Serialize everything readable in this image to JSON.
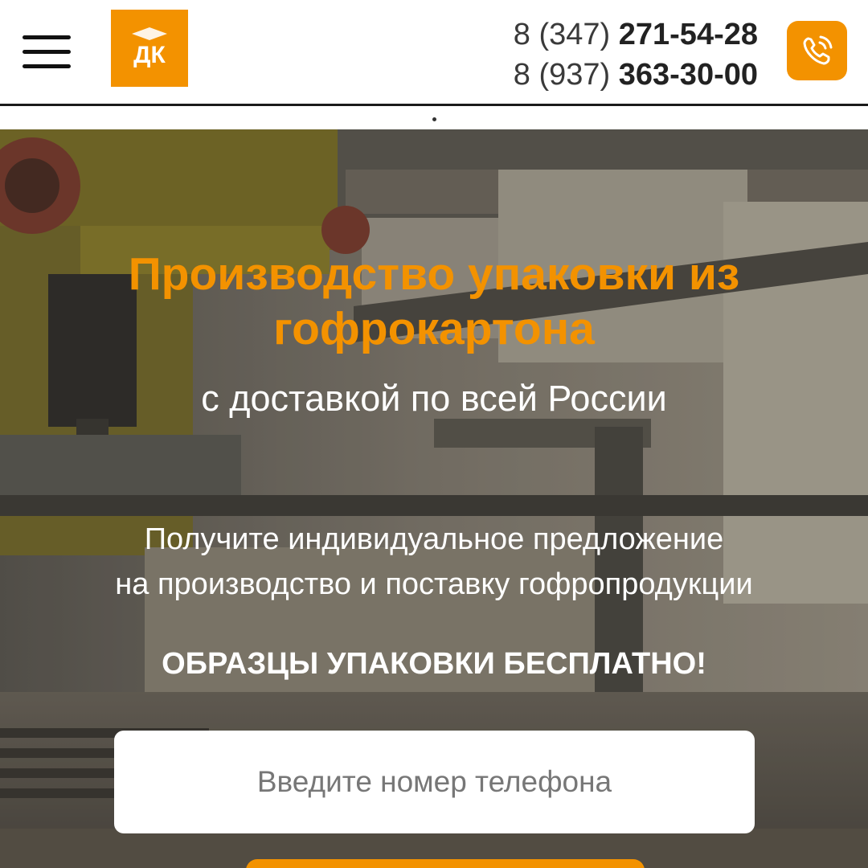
{
  "header": {
    "menu_icon": "hamburger-menu-icon",
    "logo": {
      "text": "ДК",
      "color": "#f39200"
    },
    "phones": [
      {
        "code": "8 (347)",
        "number": "271-54-28"
      },
      {
        "code": "8 (937)",
        "number": "363-30-00"
      }
    ],
    "call_icon": "phone-call-icon"
  },
  "hero": {
    "title_line1": "Производство упаковки из",
    "title_line2": "гофрокартона",
    "subtitle": "с доставкой по всей России",
    "offer_line1": "Получите индивидуальное предложение",
    "offer_line2": "на производство и поставку гофропродукции",
    "free_samples": "ОБРАЗЦЫ УПАКОВКИ БЕСПЛАТНО!",
    "phone_placeholder": "Введите номер телефона"
  },
  "colors": {
    "accent": "#f39200",
    "text_dark": "#222222",
    "white": "#ffffff"
  }
}
